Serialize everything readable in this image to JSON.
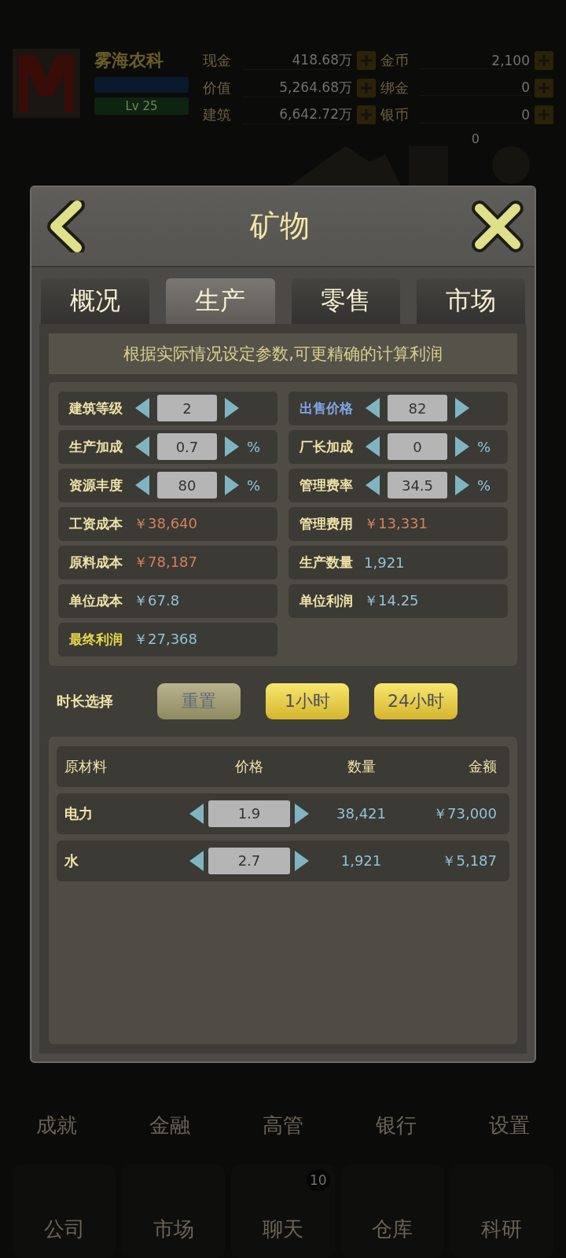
{
  "background": {
    "company": "雾海农科",
    "level": "Lv 25",
    "stats": [
      {
        "label": "现金",
        "value": "418.68万"
      },
      {
        "label": "金币",
        "value": "2,100"
      },
      {
        "label": "价值",
        "value": "5,264.68万"
      },
      {
        "label": "绑金",
        "value": "0"
      },
      {
        "label": "建筑",
        "value": "6,642.72万"
      },
      {
        "label": "银币",
        "value": "0"
      }
    ],
    "icon_badge": "0",
    "nav": [
      {
        "label": "成就"
      },
      {
        "label": "金融"
      },
      {
        "label": "高管"
      },
      {
        "label": "银行"
      },
      {
        "label": "设置"
      }
    ],
    "dock": [
      {
        "label": "公司"
      },
      {
        "label": "市场"
      },
      {
        "label": "聊天",
        "badge": "10"
      },
      {
        "label": "仓库"
      },
      {
        "label": "科研"
      }
    ]
  },
  "dialog": {
    "title": "矿物",
    "tabs": [
      {
        "label": "概况",
        "selected": false
      },
      {
        "label": "生产",
        "selected": true
      },
      {
        "label": "零售",
        "selected": false
      },
      {
        "label": "市场",
        "selected": false
      }
    ],
    "hint": "根据实际情况设定参数,可更精确的计算利润",
    "params": [
      {
        "kind": "stepper",
        "label": "建筑等级",
        "color": "#efe3a6",
        "value": "2"
      },
      {
        "kind": "stepper",
        "label": "出售价格",
        "color": "#7fa6e6",
        "value": "82"
      },
      {
        "kind": "stepper",
        "label": "生产加成",
        "color": "#efe3a6",
        "value": "0.7",
        "unit": "%"
      },
      {
        "kind": "stepper",
        "label": "厂长加成",
        "color": "#efe3a6",
        "value": "0",
        "unit": "%"
      },
      {
        "kind": "stepper",
        "label": "资源丰度",
        "color": "#efe3a6",
        "value": "80",
        "unit": "%"
      },
      {
        "kind": "stepper",
        "label": "管理费率",
        "color": "#efe3a6",
        "value": "34.5",
        "unit": "%"
      },
      {
        "kind": "readout",
        "label": "工资成本",
        "color": "#efe3a6",
        "value": "￥38,640",
        "cost": true
      },
      {
        "kind": "readout",
        "label": "管理费用",
        "color": "#efe3a6",
        "value": "￥13,331",
        "cost": true
      },
      {
        "kind": "readout",
        "label": "原料成本",
        "color": "#efe3a6",
        "value": "￥78,187",
        "cost": true
      },
      {
        "kind": "readout",
        "label": "生产数量",
        "color": "#efe3a6",
        "value": "1,921",
        "cost": false
      },
      {
        "kind": "readout",
        "label": "单位成本",
        "color": "#efe3a6",
        "value": "￥67.8",
        "cost": false
      },
      {
        "kind": "readout",
        "label": "单位利润",
        "color": "#efe3a6",
        "value": "￥14.25",
        "cost": false
      },
      {
        "kind": "readout",
        "label": "最终利润",
        "color": "#e8d84a",
        "value": "￥27,368",
        "cost": false
      }
    ],
    "duration_label": "时长选择",
    "duration_buttons": [
      {
        "kind": "reset",
        "label": "重置"
      },
      {
        "kind": "preset",
        "label": "1小时"
      },
      {
        "kind": "preset",
        "label": "24小时"
      }
    ],
    "materials": {
      "columns": [
        "原材料",
        "价格",
        "数量",
        "金额"
      ],
      "rows": [
        {
          "name": "电力",
          "price": "1.9",
          "quantity": "38,421",
          "amount": "￥73,000"
        },
        {
          "name": "水",
          "price": "2.7",
          "quantity": "1,921",
          "amount": "￥5,187"
        }
      ]
    }
  }
}
